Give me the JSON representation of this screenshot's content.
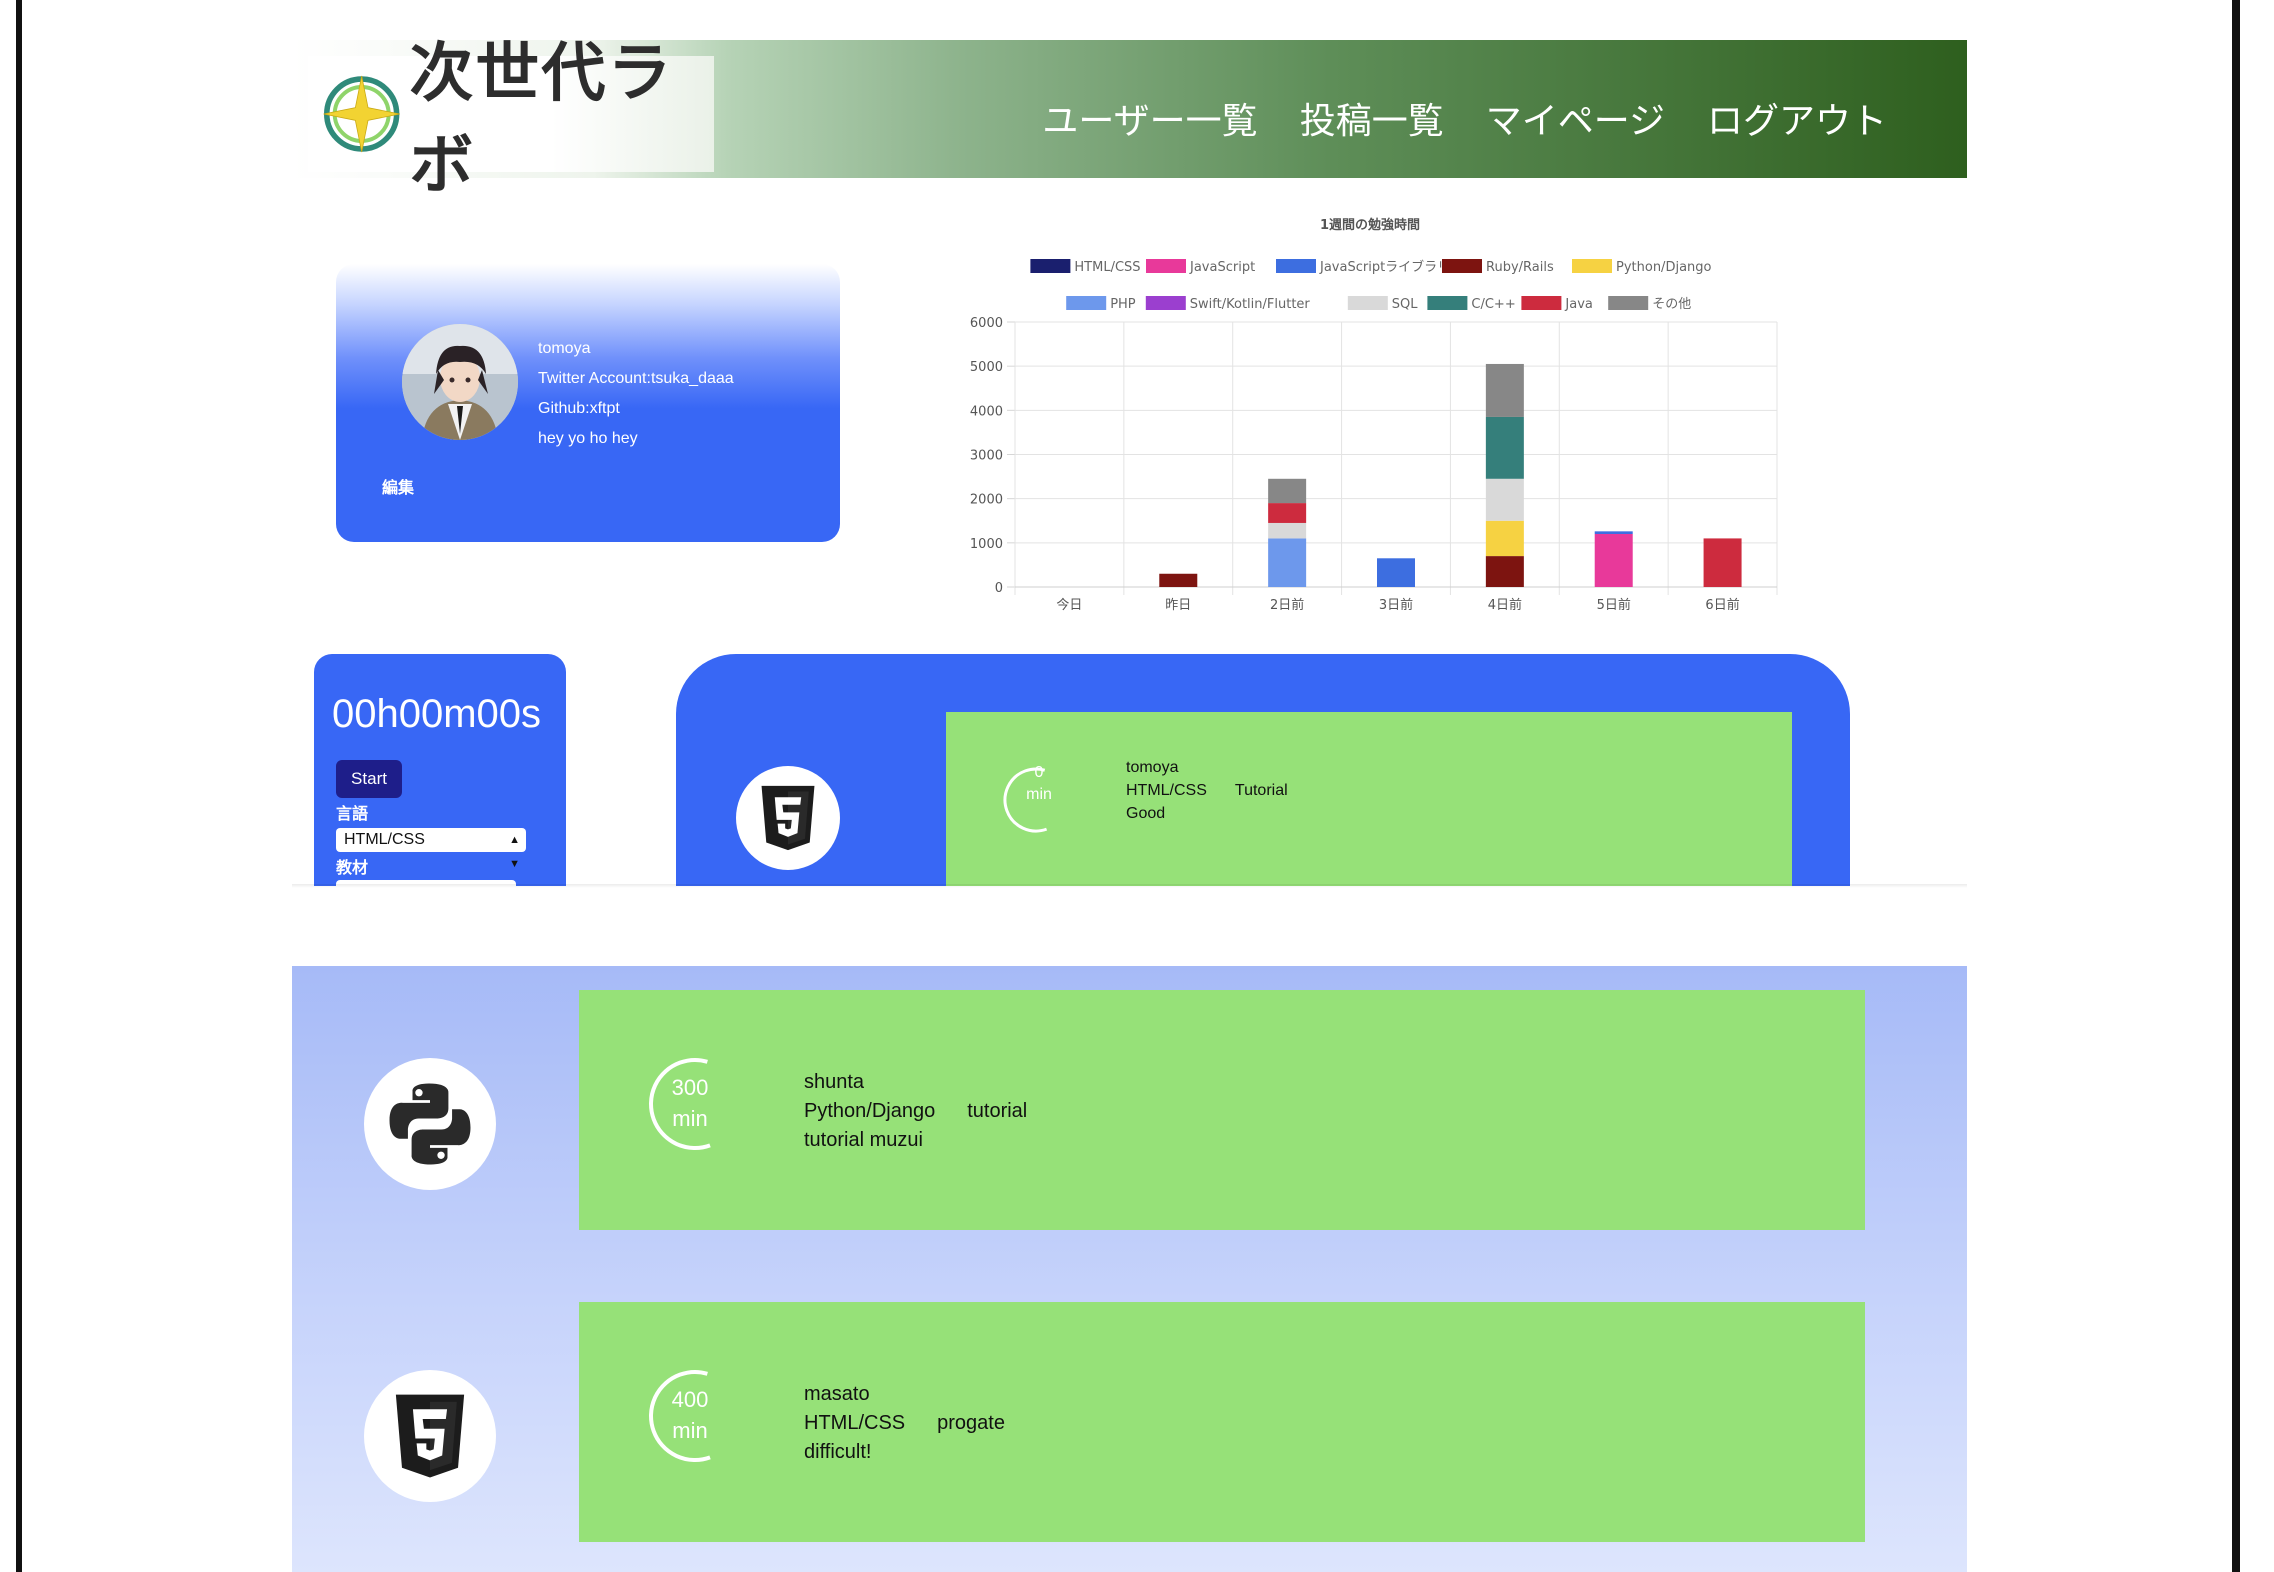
{
  "header": {
    "logo_text": "次世代ラボ",
    "nav": [
      "ユーザー一覧",
      "投稿一覧",
      "マイページ",
      "ログアウト"
    ]
  },
  "profile": {
    "name": "tomoya",
    "twitter": "Twitter Account:tsuka_daaa",
    "github": "Github:xftpt",
    "bio": "hey yo ho hey",
    "edit_label": "編集"
  },
  "chart_data": {
    "type": "bar",
    "stacked": true,
    "title": "1週間の勉強時間",
    "categories": [
      "今日",
      "昨日",
      "2日前",
      "3日前",
      "4日前",
      "5日前",
      "6日前"
    ],
    "ylim": [
      0,
      6000
    ],
    "yticks": [
      0,
      1000,
      2000,
      3000,
      4000,
      5000,
      6000
    ],
    "grid": true,
    "legend_position": "top",
    "series": [
      {
        "name": "HTML/CSS",
        "color": "#1a1f6e",
        "values": [
          0,
          0,
          0,
          0,
          0,
          0,
          0
        ]
      },
      {
        "name": "JavaScript",
        "color": "#e8399a",
        "values": [
          0,
          0,
          0,
          0,
          0,
          1200,
          0
        ]
      },
      {
        "name": "JavaScriptライブラリ",
        "color": "#3d6ee0",
        "values": [
          0,
          0,
          0,
          650,
          0,
          60,
          0
        ]
      },
      {
        "name": "Ruby/Rails",
        "color": "#7d1410",
        "values": [
          0,
          300,
          0,
          0,
          700,
          0,
          0
        ]
      },
      {
        "name": "Python/Django",
        "color": "#f6d242",
        "values": [
          0,
          0,
          0,
          0,
          800,
          0,
          0
        ]
      },
      {
        "name": "PHP",
        "color": "#6d98ec",
        "values": [
          0,
          0,
          1100,
          0,
          0,
          0,
          0
        ]
      },
      {
        "name": "Swift/Kotlin/Flutter",
        "color": "#9b3fcf",
        "values": [
          0,
          0,
          0,
          0,
          0,
          0,
          0
        ]
      },
      {
        "name": "SQL",
        "color": "#d9d9d9",
        "values": [
          0,
          0,
          350,
          0,
          950,
          0,
          0
        ]
      },
      {
        "name": "C/C++",
        "color": "#357f7b",
        "values": [
          0,
          0,
          0,
          0,
          1400,
          0,
          0
        ]
      },
      {
        "name": "Java",
        "color": "#cd2b3e",
        "values": [
          0,
          0,
          450,
          0,
          0,
          0,
          1100
        ]
      },
      {
        "name": "その他",
        "color": "#878787",
        "values": [
          0,
          0,
          550,
          0,
          1200,
          0,
          0
        ]
      }
    ]
  },
  "timer": {
    "display": "00h00m00s",
    "start_label": "Start",
    "language_label": "言語",
    "language_value": "HTML/CSS",
    "material_label": "教材"
  },
  "posts": [
    {
      "icon": "html5-icon",
      "minutes": "0",
      "unit": "min",
      "user": "tomoya",
      "language": "HTML/CSS",
      "material": "Tutorial",
      "comment": "Good",
      "progress": 0.6
    },
    {
      "icon": "python-icon",
      "minutes": "300",
      "unit": "min",
      "user": "shunta",
      "language": "Python/Django",
      "material": "tutorial",
      "comment": "tutorial muzui",
      "progress": 0.6
    },
    {
      "icon": "html5-icon",
      "minutes": "400",
      "unit": "min",
      "user": "masato",
      "language": "HTML/CSS",
      "material": "progate",
      "comment": "difficult!",
      "progress": 0.6
    }
  ],
  "colors": {
    "primary_blue": "#3867f5",
    "post_green": "#96e178",
    "header_green": "#2e5f1e"
  }
}
